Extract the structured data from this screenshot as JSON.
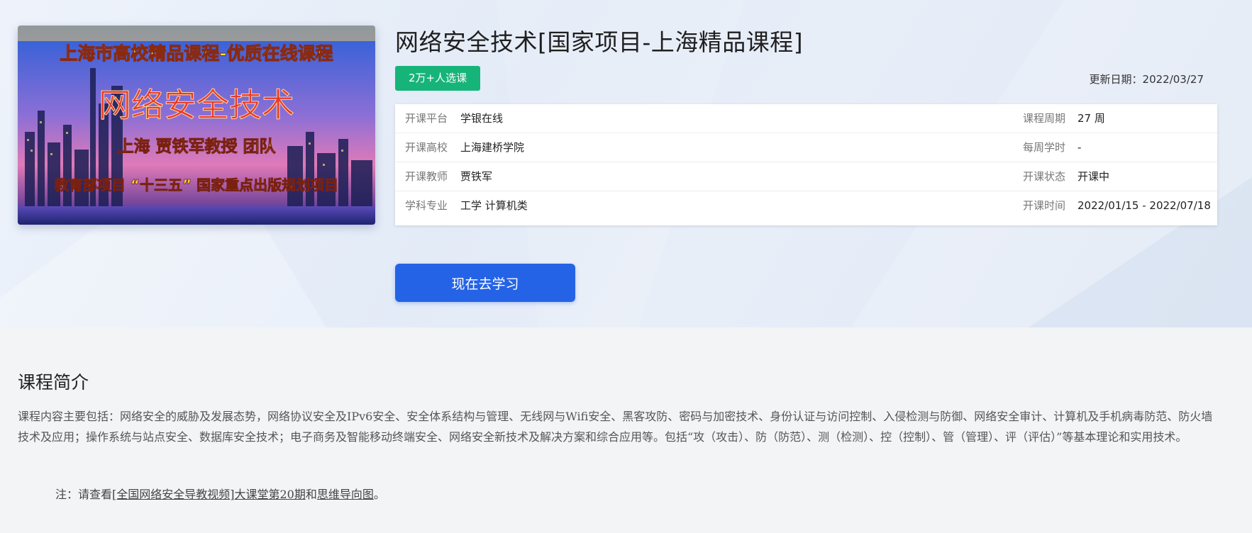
{
  "course": {
    "title": "网络安全技术[国家项目-上海精品课程]",
    "enroll_badge": "2万+人选课",
    "update_date": "更新日期：2022/03/27",
    "study_button": "现在去学习"
  },
  "cover": {
    "line1": "上海市高校精品课程-优质在线课程",
    "line2": "网络安全技术",
    "line3": "上海 贾铁军教授 团队",
    "line4": "教育部项目 “十三五” 国家重点出版规划项目"
  },
  "info_rows": [
    {
      "label_left": "开课平台",
      "value_left": "学银在线",
      "label_right": "课程周期",
      "value_right": "27 周"
    },
    {
      "label_left": "开课高校",
      "value_left": "上海建桥学院",
      "label_right": "每周学时",
      "value_right": "-"
    },
    {
      "label_left": "开课教师",
      "value_left": "贾铁军",
      "label_right": "开课状态",
      "value_right": "开课中"
    },
    {
      "label_left": "学科专业",
      "value_left": "工学 计算机类",
      "label_right": "开课时间",
      "value_right": "2022/01/15 - 2022/07/18"
    }
  ],
  "intro": {
    "heading": "课程简介",
    "body": "课程内容主要包括：网络安全的威胁及发展态势，网络协议安全及IPv6安全、安全体系结构与管理、无线网与Wifi安全、黑客攻防、密码与加密技术、身份认证与访问控制、入侵检测与防御、网络安全审计、计算机及手机病毒防范、防火墙技术及应用；操作系统与站点安全、数据库安全技术；电子商务及智能移动终端安全、网络安全新技术及解决方案和综合应用等。包括“攻（攻击）、防（防范）、测（检测）、控（控制）、管（管理）、评（评估）”等基本理论和实用技术。",
    "note_prefix": "注：请查看",
    "note_link1": "[全国网络安全导教视频]大课堂第20期",
    "note_mid": "和",
    "note_link2": "思维导向图",
    "note_suffix": "。"
  },
  "colors": {
    "badge_green": "#17b47a",
    "button_blue": "#2563e6"
  }
}
